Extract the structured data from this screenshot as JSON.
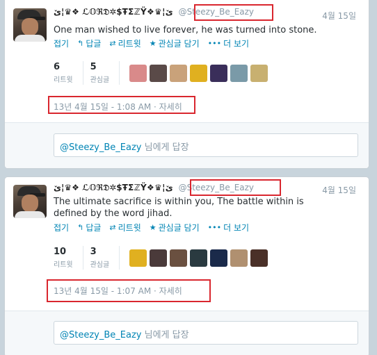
{
  "tweets": [
    {
      "fullname": "ێ¦♛❖ ℒ𝕆ℜ𝔇✲$ŦΣℤŸ❖♛¦ێ",
      "handle": "@Steezy_Be_Eazy",
      "date": "4월 15일",
      "text": "One man wished to live forever, he was turned into stone.",
      "actions": [
        "접기",
        "답글",
        "리트윗",
        "관심글 담기",
        "더 보기"
      ],
      "retweets": "6",
      "retweets_label": "리트윗",
      "favorites": "5",
      "favorites_label": "관심글",
      "timestamp": "13년 4월 15일 - 1:08 AM",
      "detail": "· 자세히",
      "reply_mention": "@Steezy_Be_Eazy",
      "reply_suffix": " 님에게 답장",
      "fav_colors": [
        "#d98a8a",
        "#5a4a48",
        "#c9a27a",
        "#e0b020",
        "#3a2e5a",
        "#7a9aa8",
        "#c8b070"
      ]
    },
    {
      "fullname": "ێ¦♛❖ ℒ𝕆ℜ𝔇✲$ŦΣℤŸ❖♛¦ێ",
      "handle": "@Steezy_Be_Eazy",
      "date": "4월 15일",
      "text": "The ultimate sacrifice is within you, The battle within is defined by the word jihad.",
      "actions": [
        "접기",
        "답글",
        "리트윗",
        "관심글 담기",
        "더 보기"
      ],
      "retweets": "10",
      "retweets_label": "리트윗",
      "favorites": "3",
      "favorites_label": "관심글",
      "timestamp": "13년 4월 15일 - 1:07 AM",
      "detail": "· 자세히",
      "reply_mention": "@Steezy_Be_Eazy",
      "reply_suffix": " 님에게 답장",
      "fav_colors": [
        "#e0b020",
        "#4a3a3a",
        "#6a5040",
        "#2a3a40",
        "#1a2a4a",
        "#b09070",
        "#4a3028"
      ]
    }
  ],
  "accent": "#0084b4",
  "highlight": "#d9262e"
}
